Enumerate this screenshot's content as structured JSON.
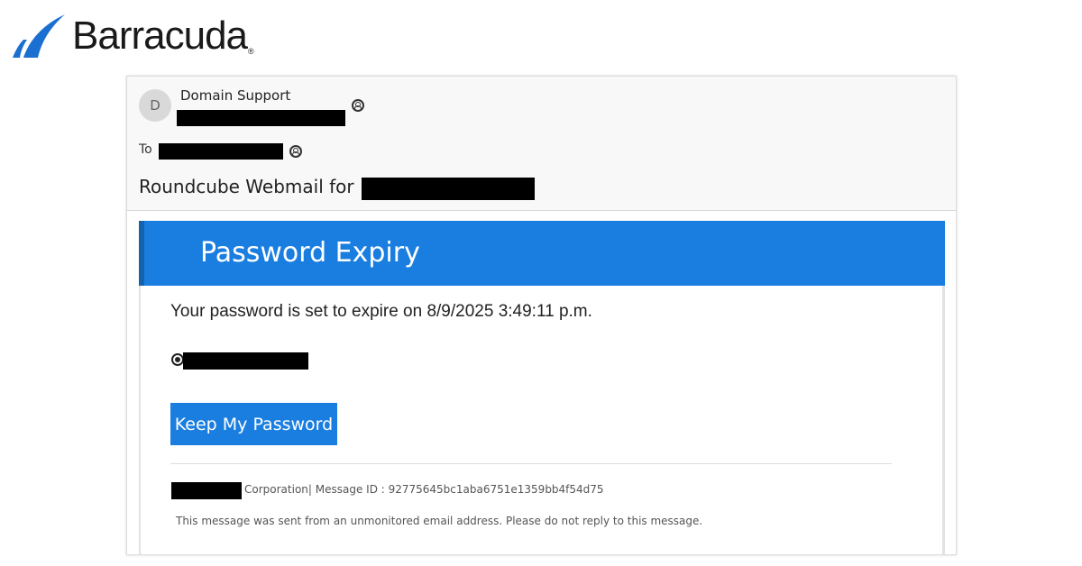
{
  "brand": {
    "name": "Barracuda",
    "mark": "®",
    "logo_icon": "barracuda-fin-icon",
    "color": "#1a6fd0"
  },
  "email": {
    "sender": {
      "avatar_initial": "D",
      "name": "Domain Support",
      "contact_icon": "contact-card-icon"
    },
    "to_label": "To",
    "subject": "Roundcube Webmail for",
    "banner_title": "Password Expiry",
    "expire_text": "Your password is set to expire on 8/9/2025 3:49:11 p.m.",
    "button_label": "Keep My Password",
    "footer_line": "Corporation| Message ID : 92775645bc1aba6751e1359bb4f54d75",
    "footer_note": "This message was sent from an unmonitored email address. Please do not reply to this message."
  },
  "colors": {
    "banner": "#1a7ee0",
    "banner_accent": "#1462ae",
    "button": "#1a7ee0",
    "redaction": "#000000"
  }
}
